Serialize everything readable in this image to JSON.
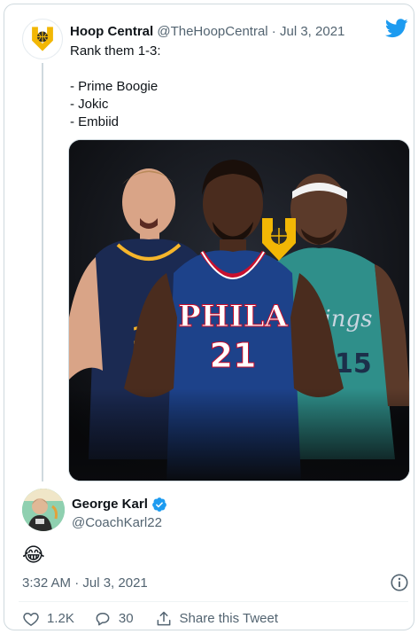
{
  "quoted_tweet": {
    "name": "Hoop Central",
    "handle": "@TheHoopCentral",
    "separator": " · ",
    "date": "Jul 3, 2021",
    "text_lines": [
      "Rank them 1-3:",
      "",
      "- Prime Boogie",
      "- Jokic",
      "- Embiid"
    ],
    "media": {
      "center_jersey_team": "PHILA",
      "center_jersey_number": "21",
      "left_jersey_number": "15",
      "right_jersey_number": "15"
    }
  },
  "reply": {
    "name": "George Karl",
    "verified": true,
    "handle": "@CoachKarl22",
    "text": "😂",
    "timestamp": "3:32 AM · Jul 3, 2021"
  },
  "actions": {
    "likes": "1.2K",
    "replies": "30",
    "share_label": "Share this Tweet"
  },
  "icons": [
    "twitter-bird-icon",
    "verified-badge-icon",
    "info-icon",
    "heart-icon",
    "reply-bubble-icon",
    "share-icon"
  ],
  "colors": {
    "twitter_blue": "#1d9bf0",
    "text_primary": "#0f1419",
    "text_secondary": "#536471",
    "border": "#cfd9de",
    "logo_gold": "#f2b705"
  }
}
